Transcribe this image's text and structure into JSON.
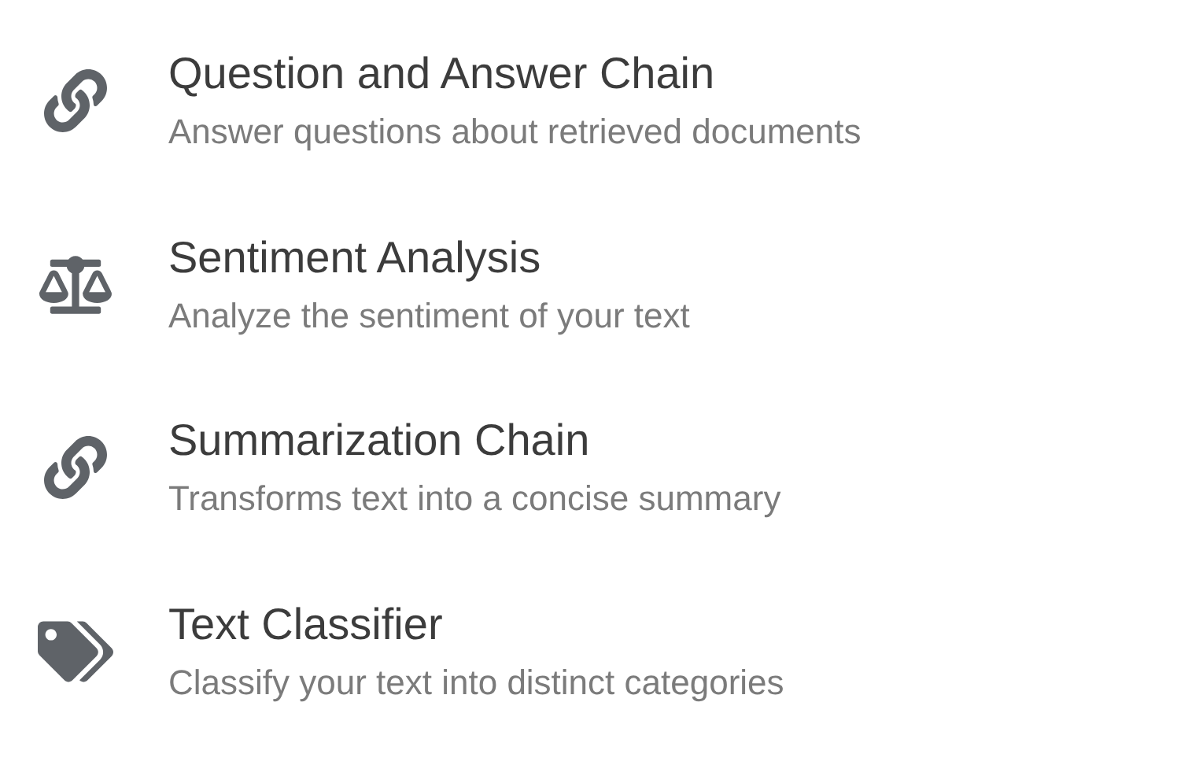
{
  "items": [
    {
      "kind": "chain",
      "title": "Question and Answer Chain",
      "description": "Answer questions about retrieved documents"
    },
    {
      "kind": "scale",
      "title": "Sentiment Analysis",
      "description": "Analyze the sentiment of your text"
    },
    {
      "kind": "chain",
      "title": "Summarization Chain",
      "description": "Transforms text into a concise summary"
    },
    {
      "kind": "tag",
      "title": "Text Classifier",
      "description": "Classify your text into distinct categories"
    }
  ]
}
